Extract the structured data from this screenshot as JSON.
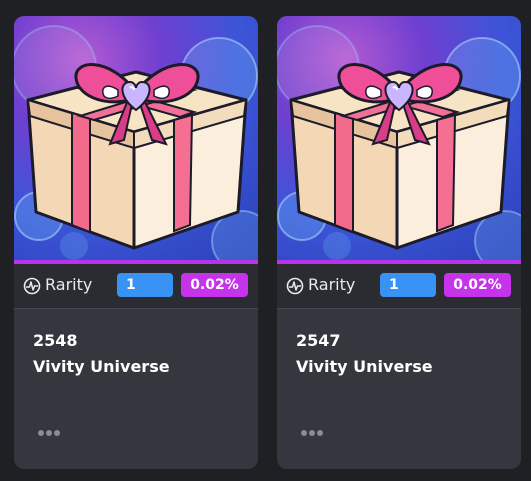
{
  "cards": [
    {
      "rarity_label": "Rarity",
      "rarity_rank": "1",
      "rarity_percent": "0.02%",
      "token_id": "2548",
      "collection_name": "Vivity Universe",
      "image": "gift-box-with-pink-bow",
      "more_icon": "ellipsis-icon"
    },
    {
      "rarity_label": "Rarity",
      "rarity_rank": "1",
      "rarity_percent": "0.02%",
      "token_id": "2547",
      "collection_name": "Vivity Universe",
      "image": "gift-box-with-pink-bow",
      "more_icon": "ellipsis-icon"
    }
  ],
  "colors": {
    "page_background": "#1f2023",
    "card_background": "#34373e",
    "rank_badge": "#3993f5",
    "percent_badge": "#c533ea",
    "accent_bar": "#b833ea"
  }
}
